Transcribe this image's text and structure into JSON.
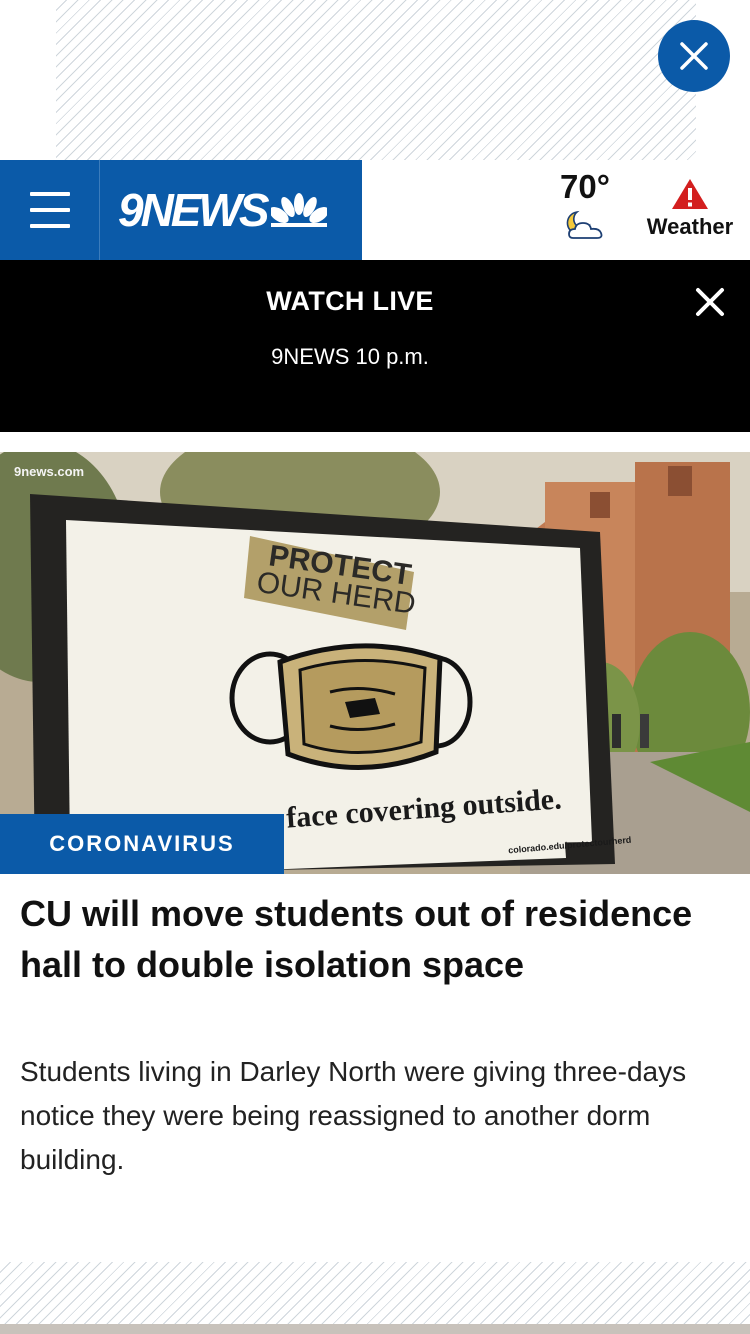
{
  "colors": {
    "brand_blue": "#0b5aa8",
    "alert_red": "#d31f1f",
    "bar_black": "#000000"
  },
  "ad": {
    "close_icon": "close-icon"
  },
  "header": {
    "menu_icon": "hamburger-menu-icon",
    "logo_text": "9NEWS",
    "temperature": "70°",
    "weather_condition_icon": "moon-cloud-icon",
    "alert_icon": "warning-triangle-icon",
    "weather_label": "Weather"
  },
  "watch_live": {
    "title": "WATCH LIVE",
    "subtitle": "9NEWS 10 p.m.",
    "close_icon": "close-icon"
  },
  "story": {
    "image_watermark": "9news.com",
    "category": "CORONAVIRUS",
    "headline": "CU will move students out of residence hall to double isolation space",
    "summary": "Students living in Darley North were giving three-days notice they were being reassigned to another dorm building.",
    "sign_text_top_1": "PROTECT",
    "sign_text_top_2": "OUR HERD",
    "sign_text_bottom": "face covering outside.",
    "sign_url": "colorado.edu/protectourherd"
  }
}
